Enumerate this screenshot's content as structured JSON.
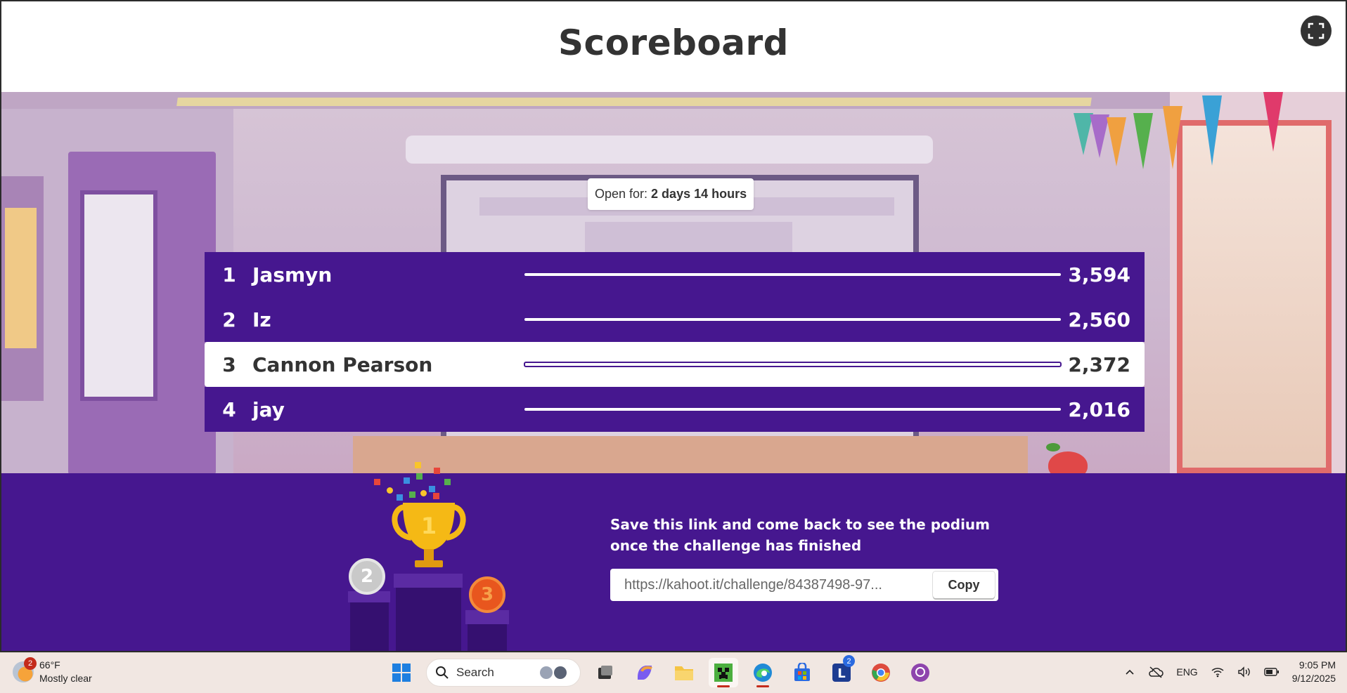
{
  "page": {
    "title": "Scoreboard"
  },
  "status": {
    "open_for_label": "Open for:",
    "open_for_value": "2 days 14 hours"
  },
  "leaderboard": [
    {
      "rank": "1",
      "name": "Jasmyn",
      "score": "3,594",
      "highlight": false
    },
    {
      "rank": "2",
      "name": "Iz",
      "score": "2,560",
      "highlight": false
    },
    {
      "rank": "3",
      "name": "Cannon Pearson",
      "score": "2,372",
      "highlight": true
    },
    {
      "rank": "4",
      "name": "jay",
      "score": "2,016",
      "highlight": false
    }
  ],
  "podium": {
    "first": "1",
    "second": "2",
    "third": "3"
  },
  "save": {
    "message": "Save this link and come back to see the podium once the challenge has finished",
    "link": "https://kahoot.it/challenge/84387498-97...",
    "copy_label": "Copy"
  },
  "taskbar": {
    "weather_temp": "66°F",
    "weather_desc": "Mostly clear",
    "weather_badge": "2",
    "search_label": "Search",
    "lang": "ENG",
    "time": "9:05 PM",
    "date": "9/12/2025",
    "app_badge": "2"
  },
  "colors": {
    "brand_purple": "#46178f",
    "highlight_row": "#ffffff"
  }
}
